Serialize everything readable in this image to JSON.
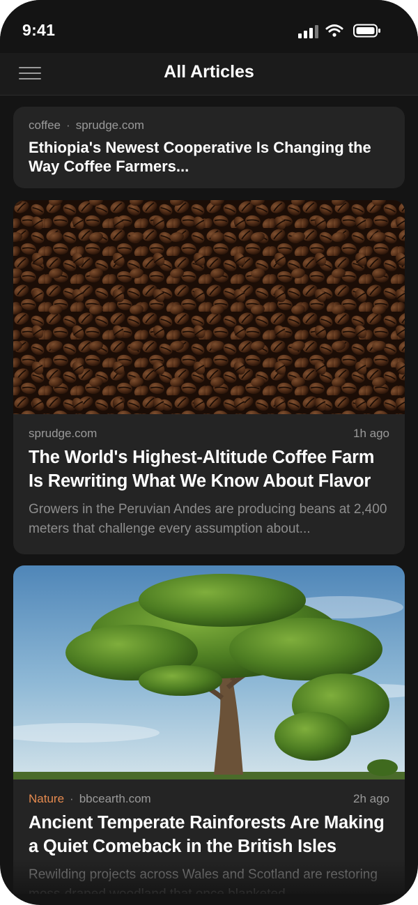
{
  "status": {
    "time": "9:41"
  },
  "nav": {
    "title": "All Articles"
  },
  "articles": [
    {
      "tag": "coffee",
      "source": "sprudge.com",
      "title": "Ethiopia's Newest Cooperative Is Changing the Way Coffee Farmers..."
    },
    {
      "image": "coffee-beans-image",
      "source": "sprudge.com",
      "time_ago": "1h ago",
      "title": "The World's Highest-Altitude Coffee Farm Is Rewriting What We Know About Flavor",
      "excerpt": "Growers in the Peruvian Andes are producing beans at 2,400 meters that challenge every assumption about..."
    },
    {
      "image": "tree-landscape-image",
      "tag": "Nature",
      "source": "bbcearth.com",
      "time_ago": "2h ago",
      "title": "Ancient Temperate Rainforests Are Making a Quiet Comeback in the British Isles",
      "excerpt": "Rewilding projects across Wales and Scotland are restoring moss-draped woodland that once blanketed..."
    }
  ],
  "colors": {
    "background": "#141414",
    "card": "#242424",
    "tag_accent": "#e58a4f",
    "meta_text": "#9a9a9a"
  }
}
